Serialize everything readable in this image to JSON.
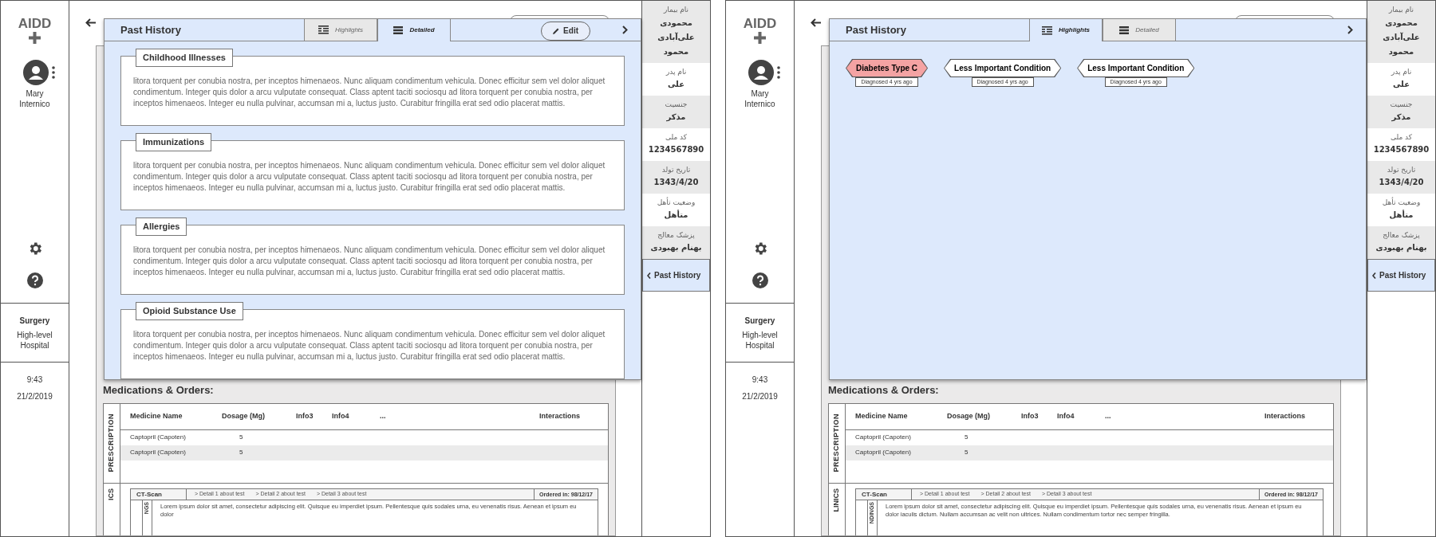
{
  "screens": [
    {
      "logo": "AIDD",
      "user_name": "Mary Internico",
      "department": "Surgery",
      "hospital": "High-level Hospital",
      "time": "9:43",
      "date": "21/2/2019",
      "panel": {
        "title": "Past History",
        "edit_button": "Edit",
        "tabs": [
          {
            "label": "Highlights",
            "kind": "highlights",
            "selected": false
          },
          {
            "label": "Detailed",
            "kind": "detailed",
            "selected": true
          }
        ],
        "sections": [
          {
            "title": "Childhood Illnesses",
            "text": "litora torquent per conubia nostra, per inceptos himenaeos. Nunc aliquam condimentum vehicula. Donec efficitur sem vel dolor aliquet condimentum. Integer quis dolor a arcu vulputate consequat. Class aptent taciti sociosqu ad litora torquent per conubia nostra, per inceptos himenaeos. Integer eu nulla pulvinar, accumsan mi a, luctus justo. Curabitur fringilla erat sed odio placerat mattis."
          },
          {
            "title": "Immunizations",
            "text": "litora torquent per conubia nostra, per inceptos himenaeos. Nunc aliquam condimentum vehicula. Donec efficitur sem vel dolor aliquet condimentum. Integer quis dolor a arcu vulputate consequat. Class aptent taciti sociosqu ad litora torquent per conubia nostra, per inceptos himenaeos. Integer eu nulla pulvinar, accumsan mi a, luctus justo. Curabitur fringilla erat sed odio placerat mattis."
          },
          {
            "title": "Allergies",
            "text": "litora torquent per conubia nostra, per inceptos himenaeos. Nunc aliquam condimentum vehicula. Donec efficitur sem vel dolor aliquet condimentum. Integer quis dolor a arcu vulputate consequat. Class aptent taciti sociosqu ad litora torquent per conubia nostra, per inceptos himenaeos. Integer eu nulla pulvinar, accumsan mi a, luctus justo. Curabitur fringilla erat sed odio placerat mattis."
          },
          {
            "title": "Opioid Substance Use",
            "text": "litora torquent per conubia nostra, per inceptos himenaeos. Nunc aliquam condimentum vehicula. Donec efficitur sem vel dolor aliquet condimentum. Integer quis dolor a arcu vulputate consequat. Class aptent taciti sociosqu ad litora torquent per conubia nostra, per inceptos himenaeos. Integer eu nulla pulvinar, accumsan mi a, luctus justo. Curabitur fringilla erat sed odio placerat mattis."
          }
        ]
      },
      "patient_fields": [
        {
          "label": "نام بیمار",
          "value": "محمودی علی‌آبادی محمود"
        },
        {
          "label": "نام پدر",
          "value": "علی"
        },
        {
          "label": "جنسیت",
          "value": "مذکر"
        },
        {
          "label": "کد ملی",
          "value": "1234567890"
        },
        {
          "label": "تاریخ تولد",
          "value": "1343/4/20"
        },
        {
          "label": "وضعیت تأهل",
          "value": "متأهل"
        },
        {
          "label": "پزشک معالج",
          "value": "بهنام بهبودی"
        }
      ],
      "nav_item": "Past History",
      "medications": {
        "title": "Medications & Orders:",
        "prescription_label": "PRESCRIPTION",
        "columns": [
          "Medicine Name",
          "Dosage (Mg)",
          "Info3",
          "Info4",
          "...",
          "Interactions"
        ],
        "rows": [
          {
            "name": "Captopril (Capoten)",
            "dosage": "5"
          },
          {
            "name": "Captopril (Capoten)",
            "dosage": "5"
          }
        ],
        "clinics_label": "ICS",
        "test": "CT-Scan",
        "details": [
          "> Detail 1 about test",
          "> Detail 2 about test",
          "> Detail 3 about test"
        ],
        "ordered": "Ordered in: 98/12/17",
        "findings_label": "NGS",
        "findings": "Lorem ipsum dolor sit amet, consectetur adipiscing elit. Quisque eu imperdiet ipsum. Pellentesque quis sodales urna, eu venenatis risus. Aenean et ipsum eu dolor"
      }
    },
    {
      "logo": "AIDD",
      "user_name": "Mary Internico",
      "department": "Surgery",
      "hospital": "High-level Hospital",
      "time": "9:43",
      "date": "21/2/2019",
      "panel": {
        "title": "Past History",
        "tabs": [
          {
            "label": "Highlights",
            "kind": "highlights",
            "selected": true
          },
          {
            "label": "Detailed",
            "kind": "detailed",
            "selected": false
          }
        ],
        "conditions": [
          {
            "label": "Diabetes Type C",
            "note": "Diagnosed 4 yrs ago",
            "color": "#f4a3a3"
          },
          {
            "label": "Less Important Condition",
            "note": "Diagnosed 4 yrs ago",
            "color": "#ffffff"
          },
          {
            "label": "Less Important Condition",
            "note": "Diagnosed 4 yrs ago",
            "color": "#ffffff"
          }
        ]
      },
      "patient_fields": [
        {
          "label": "نام بیمار",
          "value": "محمودی علی‌آبادی محمود"
        },
        {
          "label": "نام پدر",
          "value": "علی"
        },
        {
          "label": "جنسیت",
          "value": "مذکر"
        },
        {
          "label": "کد ملی",
          "value": "1234567890"
        },
        {
          "label": "تاریخ تولد",
          "value": "1343/4/20"
        },
        {
          "label": "وضعیت تأهل",
          "value": "متأهل"
        },
        {
          "label": "پزشک معالج",
          "value": "بهنام بهبودی"
        }
      ],
      "nav_item": "Past History",
      "medications": {
        "title": "Medications & Orders:",
        "prescription_label": "PRESCRIPTION",
        "columns": [
          "Medicine Name",
          "Dosage (Mg)",
          "Info3",
          "Info4",
          "...",
          "Interactions"
        ],
        "rows": [
          {
            "name": "Captopril (Capoten)",
            "dosage": "5"
          },
          {
            "name": "Captopril (Capoten)",
            "dosage": "5"
          }
        ],
        "clinics_label": "LINICS",
        "test": "CT-Scan",
        "details": [
          "> Detail 1 about test",
          "> Detail 2 about test",
          "> Detail 3 about test"
        ],
        "ordered": "Ordered in: 98/12/17",
        "findings_label": "NDINGS",
        "findings": "Lorem ipsum dolor sit amet, consectetur adipiscing elit. Quisque eu imperdiet ipsum. Pellentesque quis sodales urna, eu venenatis risus. Aenean et ipsum eu dolor iaculis dictum. Nullam accumsan ac velit non ultrices. Nullam condimentum tortor nec semper fringilla."
      }
    }
  ]
}
